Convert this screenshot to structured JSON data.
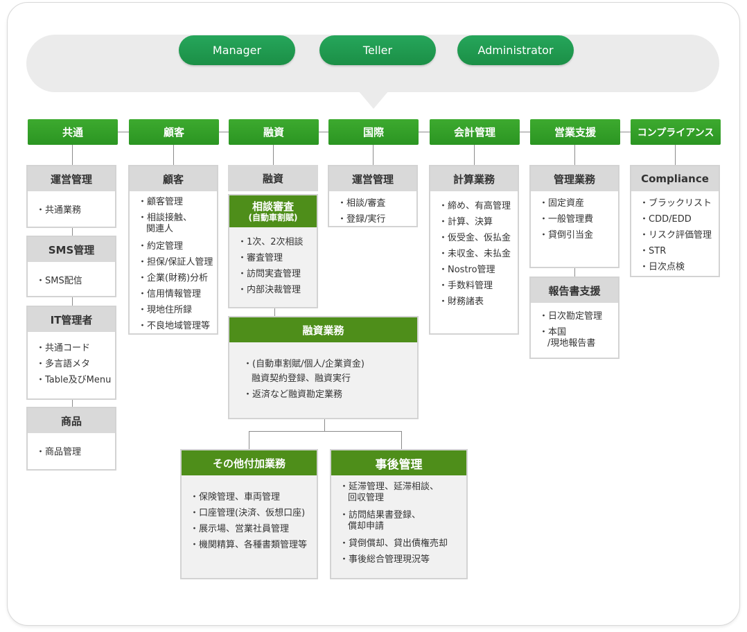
{
  "roles": [
    "Manager",
    "Teller",
    "Administrator"
  ],
  "categories": [
    "共通",
    "顧客",
    "融資",
    "国際",
    "会計管理",
    "営業支援",
    "コンプライアンス"
  ],
  "boxes": {
    "kyotsu_unei": {
      "title": "運営管理",
      "items": [
        "・共通業務"
      ]
    },
    "sms": {
      "title": "SMS管理",
      "items": [
        "・SMS配信"
      ]
    },
    "it": {
      "title": "IT管理者",
      "items": [
        "・共通コード",
        "・多言語メタ",
        "・Table及びMenu"
      ]
    },
    "shohin": {
      "title": "商品",
      "items": [
        "・商品管理"
      ]
    },
    "kokyaku": {
      "title": "顧客",
      "items": [
        "・顧客管理",
        "・相談接触、",
        "関連人",
        "・約定管理",
        "・担保/保証人管理",
        "・企業(財務)分析",
        "・信用情報管理",
        "・現地住所録",
        "・不良地域管理等"
      ]
    },
    "yushi": {
      "title": "融資"
    },
    "sodan": {
      "title": "相談審査",
      "subtitle": "(自動車割賦)",
      "items": [
        "・1次、2次相談",
        "・審査管理",
        "・訪問実査管理",
        "・内部決裁管理"
      ]
    },
    "yushi_gyomu": {
      "title": "融資業務",
      "items": [
        "・(自動車割賦/個人/企業資金)",
        "融資契約登録、融資実行",
        "・返済など融資勘定業務"
      ]
    },
    "sonota": {
      "title": "その他付加業務",
      "items": [
        "・保険管理、車両管理",
        "・口座管理(決済、仮想口座)",
        "・展示場、営業社員管理",
        "・機関精算、各種書類管理等"
      ]
    },
    "jigo": {
      "title": "事後管理",
      "items": [
        "・延滞管理、延滞相談、",
        "回収管理",
        "・訪問結果書登録、",
        "償却申請",
        "・貸倒償却、貸出債権売却",
        "・事後総合管理現況等"
      ]
    },
    "kokusai_unei": {
      "title": "運営管理",
      "items": [
        "・相談/審査",
        "・登録/実行"
      ]
    },
    "keisan": {
      "title": "計算業務",
      "items": [
        "・締め、有高管理",
        "・計算、決算",
        "・仮受金、仮払金",
        "・未収金、未払金",
        "・Nostro管理",
        "・手数料管理",
        "・財務諸表"
      ]
    },
    "kanri": {
      "title": "管理業務",
      "items": [
        "・固定資産",
        "・一般管理費",
        "・貸倒引当金"
      ]
    },
    "hokoku": {
      "title": "報告書支援",
      "items": [
        "・日次勘定管理",
        "・本国",
        "/現地報告書"
      ]
    },
    "compliance": {
      "title": "Compliance",
      "items": [
        "・ブラックリスト",
        "・CDD/EDD",
        "・リスク評価管理",
        "・STR",
        "・日次点検"
      ]
    }
  },
  "colors": {
    "role_green": "#1b9a4f",
    "category_green": "#33a028",
    "header_green": "#4e8e1a",
    "header_gray": "#d9d9d9"
  }
}
